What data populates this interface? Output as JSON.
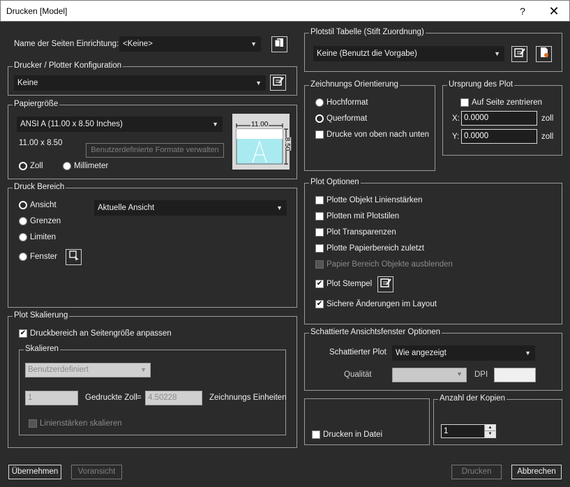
{
  "window": {
    "title": "Drucken [Model]",
    "help": "?",
    "close": "✕"
  },
  "page_setup": {
    "label": "Name der Seiten Einrichtung:",
    "value": "<Keine>"
  },
  "printer": {
    "legend": "Drucker / Plotter Konfiguration",
    "value": "Keine"
  },
  "paper": {
    "legend": "Papiergröße",
    "value": "ANSI A (11.00 x 8.50 Inches)",
    "dimensions": "11.00 x 8.50",
    "custom_formats_button": "Benutzerdefinierte Formate verwalten",
    "unit_inch": "Zoll",
    "unit_mm": "Millimeter",
    "preview_width": "11.00",
    "preview_height": "8.50",
    "preview_letter": "A"
  },
  "print_area": {
    "legend": "Druck Bereich",
    "options": [
      "Ansicht",
      "Grenzen",
      "Limiten",
      "Fenster"
    ],
    "view_value": "Aktuelle Ansicht"
  },
  "plot_scale": {
    "legend": "Plot Skalierung",
    "fit_label": "Druckbereich an Seitengröße anpassen",
    "scale_legend": "Skalieren",
    "scale_value": "Benutzerdefiniert",
    "left_value": "1",
    "printed_label": "Gedruckte Zoll",
    "equals": "=",
    "right_value": "4.50228",
    "units_label": "Zeichnungs Einheiten",
    "lineweights_label": "Linienstärken skalieren"
  },
  "plotstyle": {
    "legend": "Plotstil Tabelle (Stift Zuordnung)",
    "value": "Keine (Benutzt die Vorgabe)"
  },
  "orientation": {
    "legend": "Zeichnungs Orientierung",
    "portrait": "Hochformat",
    "landscape": "Querformat",
    "upside_down": "Drucke von oben nach unten"
  },
  "origin": {
    "legend": "Ursprung des Plot",
    "center_label": "Auf Seite zentrieren",
    "x_label": "X:",
    "x_value": "0.0000",
    "y_label": "Y:",
    "y_value": "0.0000",
    "unit": "zoll"
  },
  "plot_options": {
    "legend": "Plot Optionen",
    "items": [
      "Plotte Objekt Linienstärken",
      "Plotten mit Plotstilen",
      "Plot Transparenzen",
      "Plotte Papierbereich zuletzt",
      "Papier Bereich Objekte ausblenden",
      "Plot Stempel",
      "Sichere Änderungen im Layout"
    ]
  },
  "shaded": {
    "legend": "Schattierte Ansichtsfenster Optionen",
    "shaded_label": "Schattierter Plot",
    "shaded_value": "Wie angezeigt",
    "quality_label": "Qualität",
    "dpi_label": "DPI"
  },
  "print_to_file": {
    "label": "Drucken in Datei"
  },
  "copies": {
    "legend": "Anzahl der Kopien",
    "value": "1"
  },
  "footer": {
    "apply": "Übernehmen",
    "preview": "Voransicht",
    "print": "Drucken",
    "cancel": "Abbrechen"
  }
}
